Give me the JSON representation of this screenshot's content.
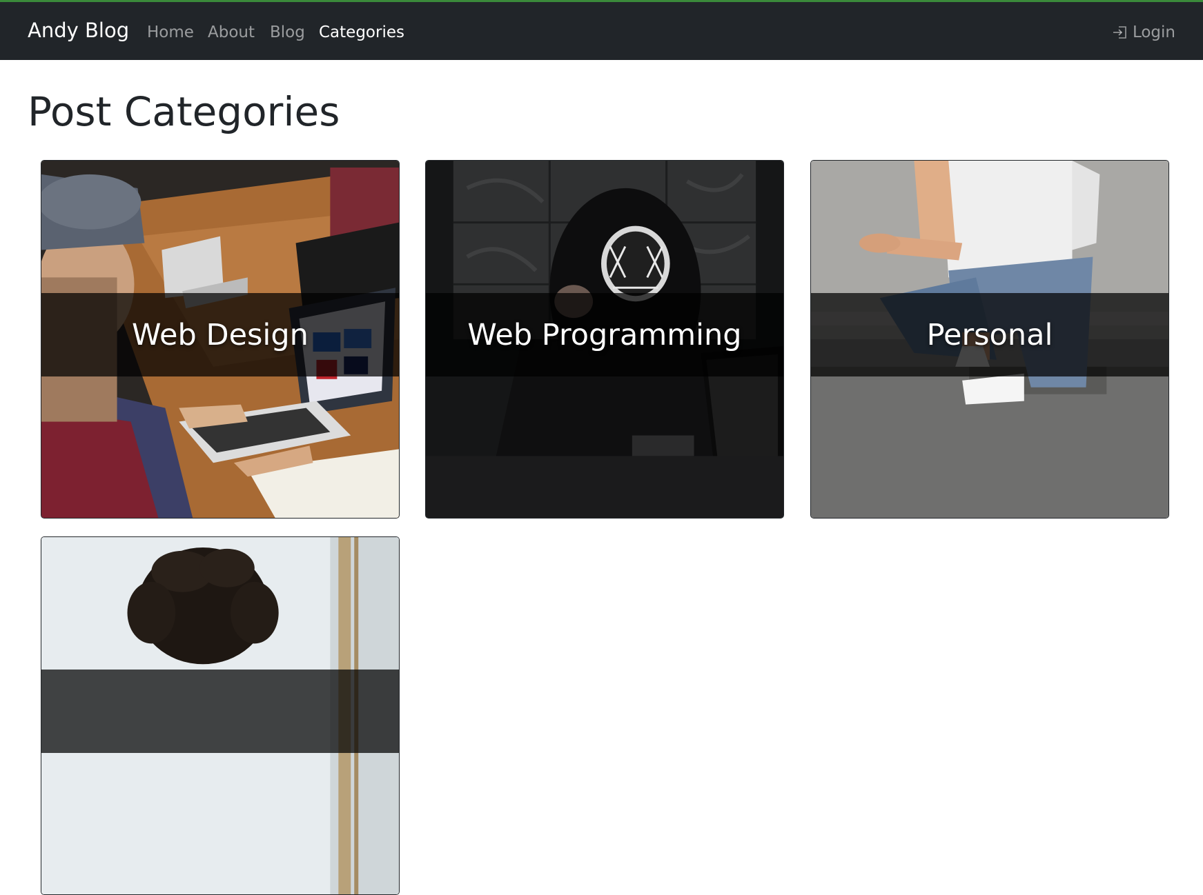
{
  "navbar": {
    "brand": "Andy Blog",
    "links": [
      {
        "label": "Home",
        "active": false
      },
      {
        "label": "About",
        "active": false
      },
      {
        "label": "Blog",
        "active": false
      },
      {
        "label": "Categories",
        "active": true
      }
    ],
    "login": {
      "label": "Login",
      "icon": "login-icon"
    }
  },
  "page": {
    "title": "Post Categories"
  },
  "categories": [
    {
      "label": "Web Design",
      "image": "team-laptops-photo"
    },
    {
      "label": "Web Programming",
      "image": "hooded-hacker-photo"
    },
    {
      "label": "Personal",
      "image": "crouching-man-photo"
    },
    {
      "label": "",
      "image": "curly-hair-woman-photo"
    }
  ],
  "colors": {
    "navbar_bg": "#212529",
    "accent_line": "#3a8a3a",
    "overlay": "rgba(0,0,0,0.72)"
  }
}
